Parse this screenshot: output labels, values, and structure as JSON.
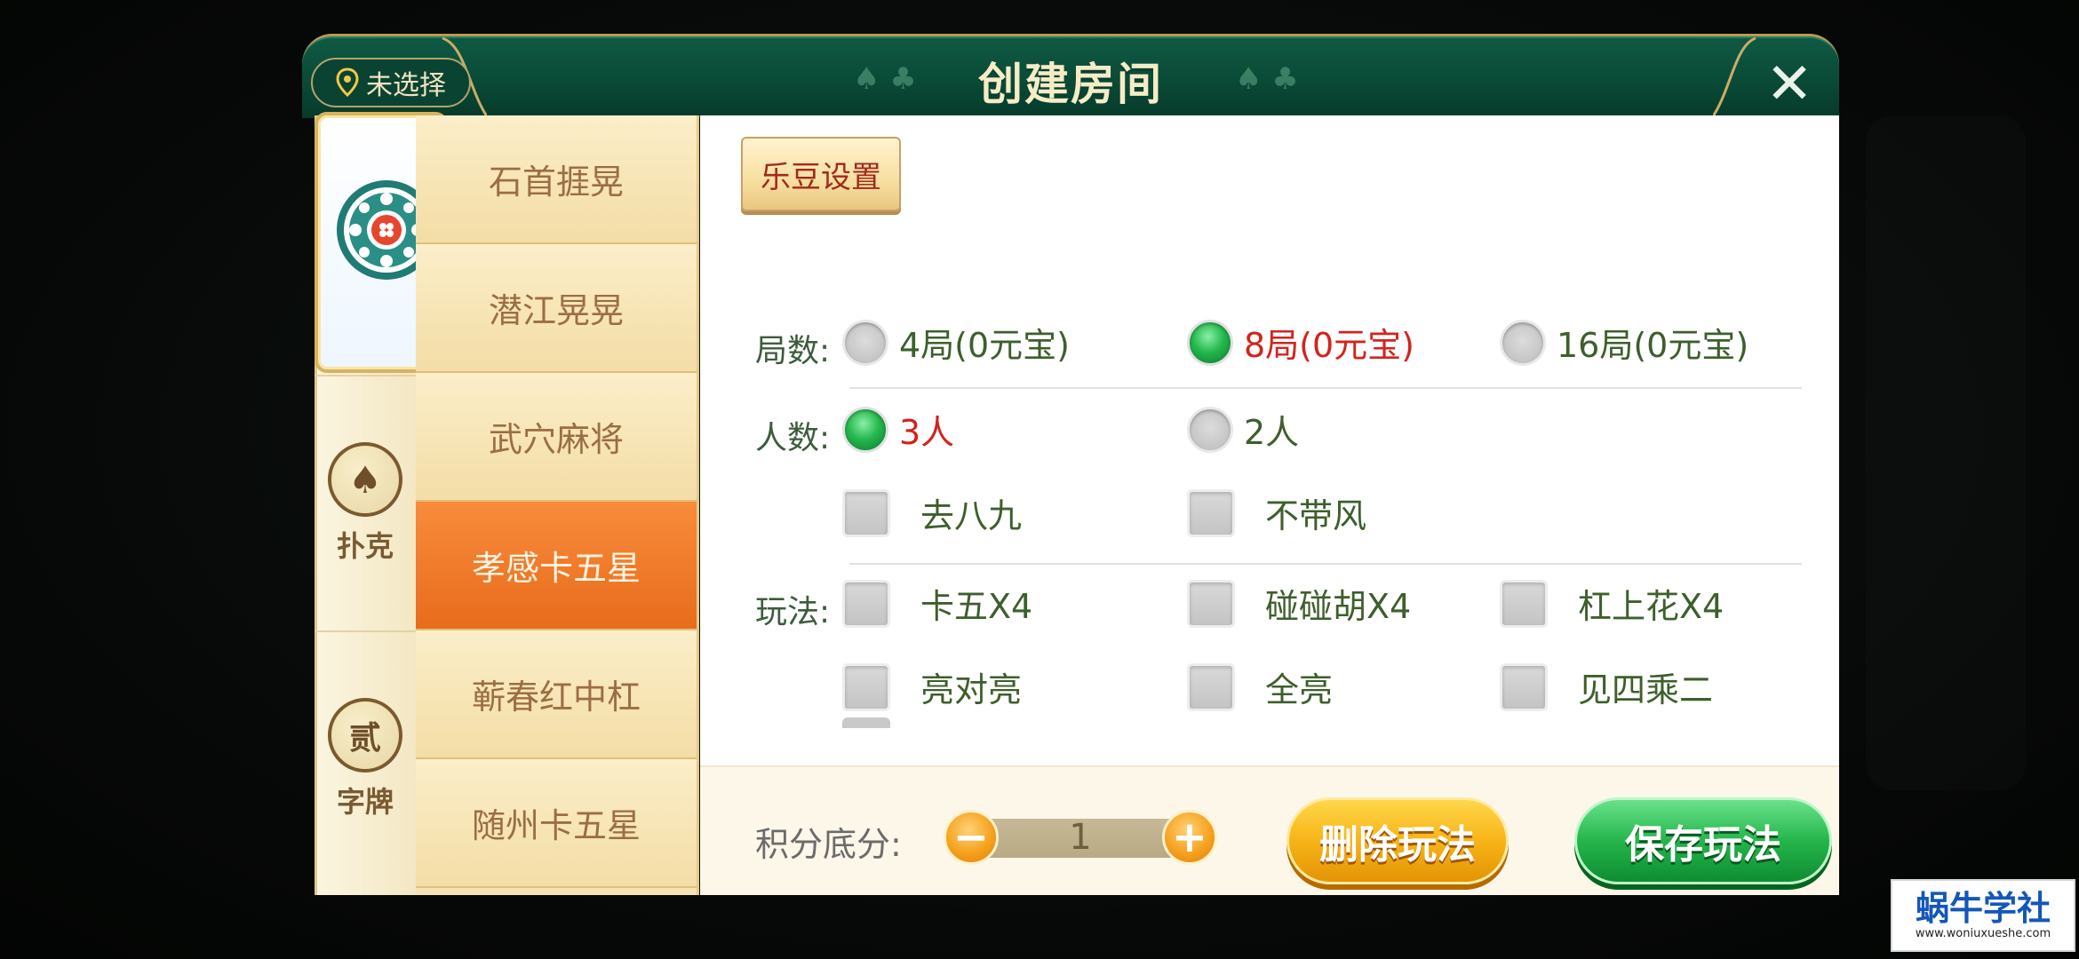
{
  "dialog": {
    "title": "创建房间",
    "location": "未选择",
    "close_symbol": "✕"
  },
  "sidebar": {
    "tabs": [
      {
        "label": "",
        "icon": "mahjong-emblem-icon",
        "active": true
      },
      {
        "label": "扑克",
        "icon": "spade-icon",
        "symbol": "♠"
      },
      {
        "label": "字牌",
        "icon": "char-tile-icon",
        "symbol": "贰"
      }
    ]
  },
  "games": [
    {
      "label": "石首捱晃"
    },
    {
      "label": "潜江晃晃"
    },
    {
      "label": "武穴麻将"
    },
    {
      "label": "孝感卡五星",
      "active": true
    },
    {
      "label": "蕲春红中杠"
    },
    {
      "label": "随州卡五星"
    }
  ],
  "settings": {
    "ledou_button": "乐豆设置",
    "rounds": {
      "label": "局数:",
      "options": [
        "4局(0元宝)",
        "8局(0元宝)",
        "16局(0元宝)"
      ],
      "selected": 1
    },
    "players": {
      "label": "人数:",
      "options": [
        "3人",
        "2人"
      ],
      "selected": 0,
      "extras": [
        "去八九",
        "不带风"
      ]
    },
    "rules": {
      "label": "玩法:",
      "options": [
        "卡五X4",
        "碰碰胡X4",
        "杠上花X4",
        "亮对亮",
        "全亮",
        "见四乘二"
      ]
    }
  },
  "footer": {
    "score_label": "积分底分:",
    "score_value": "1",
    "minus_symbol": "−",
    "plus_symbol": "+",
    "delete_button": "删除玩法",
    "save_button": "保存玩法"
  },
  "watermark": {
    "title": "蜗牛学社",
    "url": "www.woniuxueshe.com"
  },
  "colors": {
    "title_bar": "#0a4a37",
    "selected_text": "#d3231d",
    "option_text": "#3d5f2c",
    "active_game": "#e86c1c",
    "save_button": "#25b54c",
    "delete_button": "#f7b418"
  }
}
